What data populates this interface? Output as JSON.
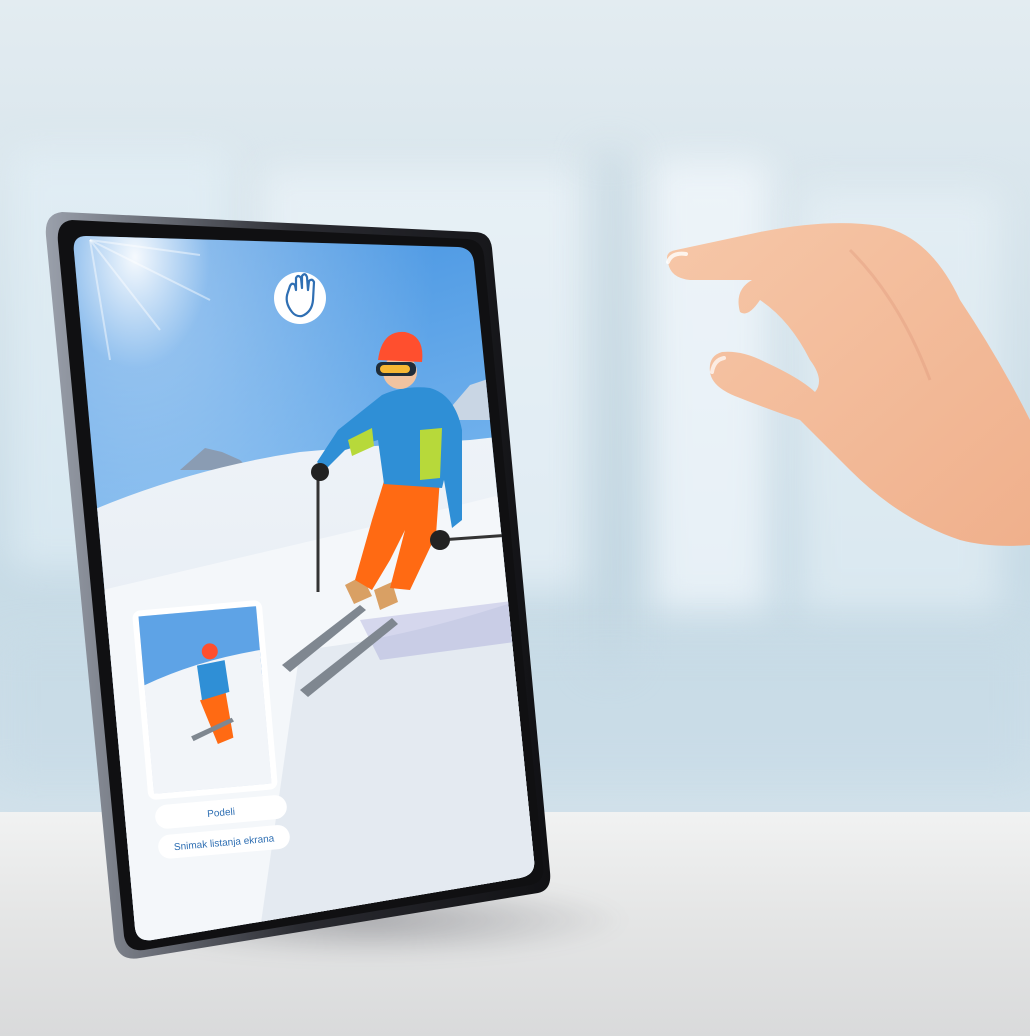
{
  "screen": {
    "gesture_icon": "hand-grab-icon",
    "screenshot_preview": {
      "actions": [
        {
          "label": "Podeli"
        },
        {
          "label": "Snimak listanja ekrana"
        }
      ]
    }
  },
  "colors": {
    "action_text": "#2f6fb3",
    "device_frame": "#141416",
    "skier_jacket": "#2f8fd6",
    "skier_pants": "#ff6a13",
    "skier_helmet": "#ff4f2e"
  }
}
